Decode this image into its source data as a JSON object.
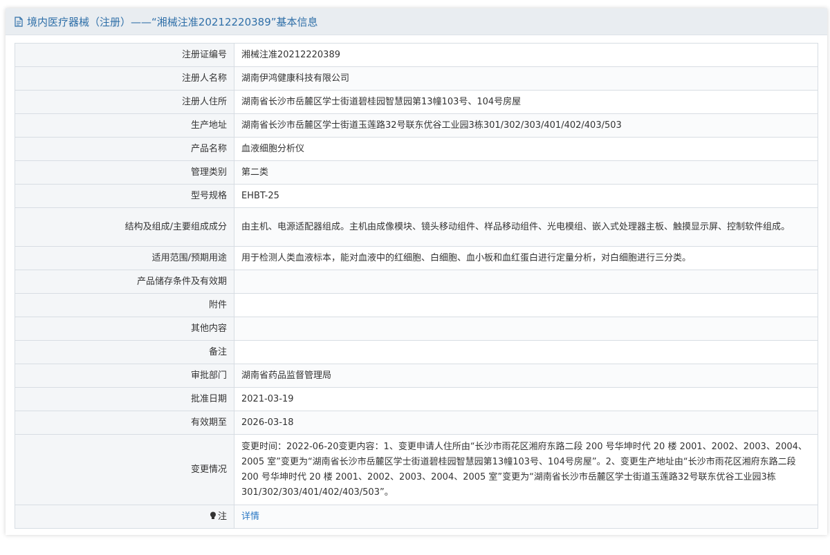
{
  "header": {
    "title": "境内医疗器械（注册）——“湘械注准20212220389”基本信息",
    "icon": "document-icon"
  },
  "rows": [
    {
      "label": "注册证编号",
      "value": "湘械注准20212220389"
    },
    {
      "label": "注册人名称",
      "value": "湖南伊鸿健康科技有限公司"
    },
    {
      "label": "注册人住所",
      "value": "湖南省长沙市岳麓区学士街道碧桂园智慧园第13幢103号、104号房屋"
    },
    {
      "label": "生产地址",
      "value": "湖南省长沙市岳麓区学士街道玉莲路32号联东优谷工业园3栋301/302/303/401/402/403/503"
    },
    {
      "label": "产品名称",
      "value": "血液细胞分析仪"
    },
    {
      "label": "管理类别",
      "value": "第二类"
    },
    {
      "label": "型号规格",
      "value": "EHBT-25"
    },
    {
      "label": "结构及组成/主要组成成分",
      "value": "由主机、电源适配器组成。主机由成像模块、镜头移动组件、样品移动组件、光电模组、嵌入式处理器主板、触摸显示屏、控制软件组成。"
    },
    {
      "label": "适用范围/预期用途",
      "value": "用于检测人类血液标本，能对血液中的红细胞、白细胞、血小板和血红蛋白进行定量分析，对白细胞进行三分类。"
    },
    {
      "label": "产品储存条件及有效期",
      "value": ""
    },
    {
      "label": "附件",
      "value": ""
    },
    {
      "label": "其他内容",
      "value": ""
    },
    {
      "label": "备注",
      "value": ""
    },
    {
      "label": "审批部门",
      "value": "湖南省药品监督管理局"
    },
    {
      "label": "批准日期",
      "value": "2021-03-19"
    },
    {
      "label": "有效期至",
      "value": "2026-03-18"
    },
    {
      "label": "变更情况",
      "value": "变更时间：2022-06-20变更内容：1、变更申请人住所由“长沙市雨花区湘府东路二段 200 号华坤时代 20 楼 2001、2002、2003、2004、2005 室”变更为“湖南省长沙市岳麓区学士街道碧桂园智慧园第13幢103号、104号房屋”。2、变更生产地址由“长沙市雨花区湘府东路二段 200 号华坤时代 20 楼 2001、2002、2003、2004、2005 室”变更为“湖南省长沙市岳麓区学士街道玉莲路32号联东优谷工业园3栋301/302/303/401/402/403/503”。"
    }
  ],
  "note": {
    "label": "注",
    "icon": "lightbulb-icon",
    "link": "详情"
  },
  "colors": {
    "header_text": "#2f6fa8",
    "link": "#2b78c5",
    "label_bg": "#f4f6f8",
    "border": "#d7dde3"
  }
}
